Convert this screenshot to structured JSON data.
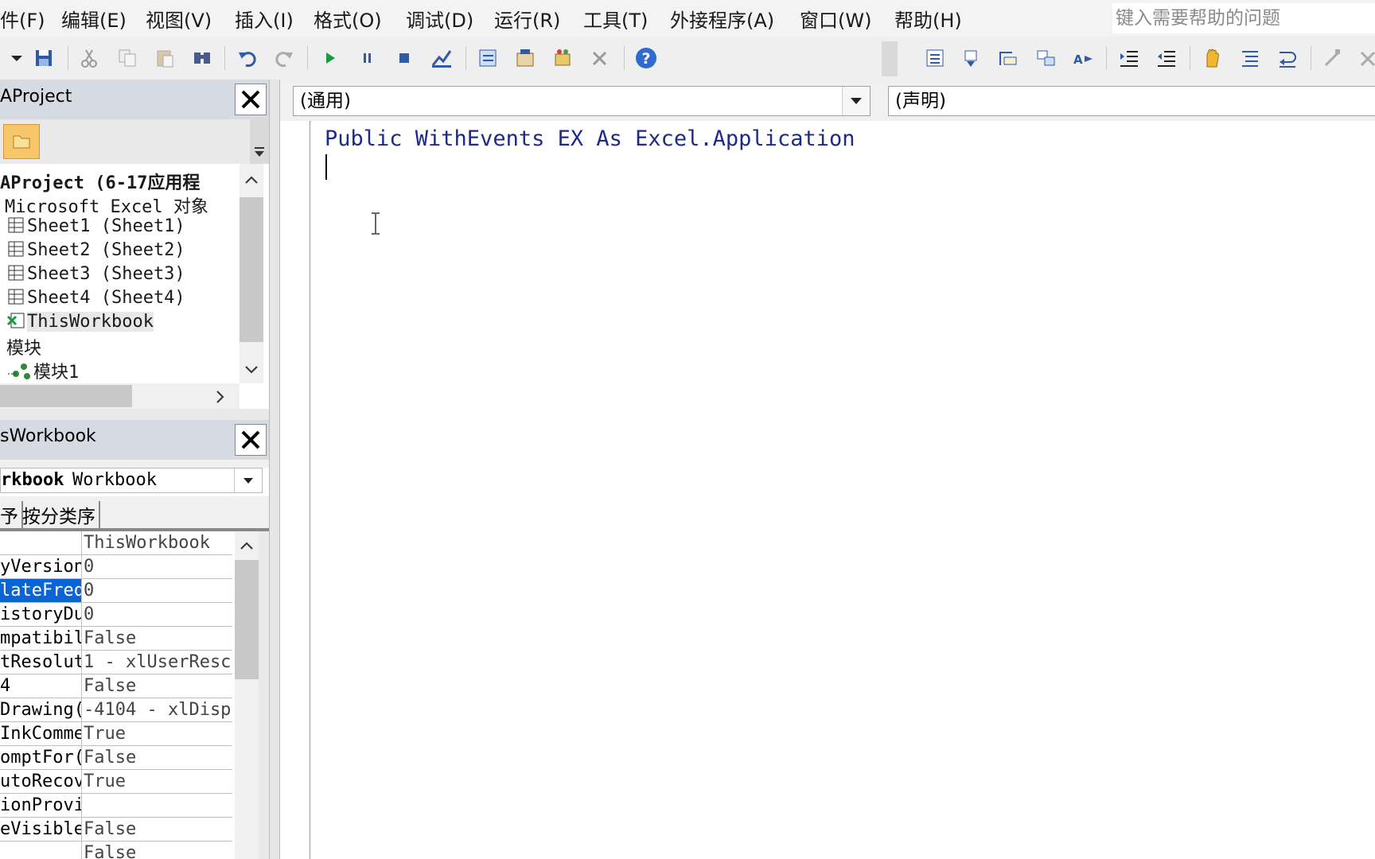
{
  "menubar": {
    "items": [
      "件(F)",
      "编辑(E)",
      "视图(V)",
      "插入(I)",
      "格式(O)",
      "调试(D)",
      "运行(R)",
      "工具(T)",
      "外接程序(A)",
      "窗口(W)",
      "帮助(H)"
    ],
    "help_placeholder": "键入需要帮助的问题"
  },
  "project_panel": {
    "title": "AProject",
    "tree": [
      {
        "label": "AProject (6-17应用程",
        "bold": true,
        "icon": ""
      },
      {
        "label": "Microsoft Excel 对象",
        "icon": ""
      },
      {
        "label": "Sheet1 (Sheet1)",
        "icon": "sheet-icon"
      },
      {
        "label": "Sheet2 (Sheet2)",
        "icon": "sheet-icon"
      },
      {
        "label": "Sheet3 (Sheet3)",
        "icon": "sheet-icon"
      },
      {
        "label": "Sheet4 (Sheet4)",
        "icon": "sheet-icon"
      },
      {
        "label": "ThisWorkbook",
        "icon": "workbook-icon",
        "selected": true
      },
      {
        "label": "模块",
        "icon": ""
      },
      {
        "label": "模块1",
        "icon": "module-icon"
      }
    ]
  },
  "properties_panel": {
    "title": "sWorkbook",
    "object_name": "rkbook",
    "object_type": "Workbook",
    "tabs": [
      "予",
      "按分类序"
    ],
    "rows": [
      {
        "name": "",
        "value": "ThisWorkbook"
      },
      {
        "name": "yVersion",
        "value": "0"
      },
      {
        "name": "lateFrequ",
        "value": "0",
        "selected": true
      },
      {
        "name": "istoryDu",
        "value": "0"
      },
      {
        "name": "mpatibil",
        "value": "False"
      },
      {
        "name": "tResolut",
        "value": "1 - xlUserResc"
      },
      {
        "name": "4",
        "value": "False"
      },
      {
        "name": "Drawing(",
        "value": "-4104 - xlDisp"
      },
      {
        "name": "InkComme",
        "value": "True"
      },
      {
        "name": "omptFor(",
        "value": "False"
      },
      {
        "name": "utoRecov",
        "value": "True"
      },
      {
        "name": "ionProvi",
        "value": ""
      },
      {
        "name": "eVisible",
        "value": "False"
      },
      {
        "name": "",
        "value": "False"
      }
    ]
  },
  "code_window": {
    "object_combo": "(通用)",
    "procedure_combo": "(声明)",
    "lines": [
      "Public WithEvents EX As Excel.Application"
    ]
  },
  "colors": {
    "code_keyword": "#1e2a8a",
    "selection": "#0a64d6",
    "panel_title": "#d6dbe3"
  }
}
